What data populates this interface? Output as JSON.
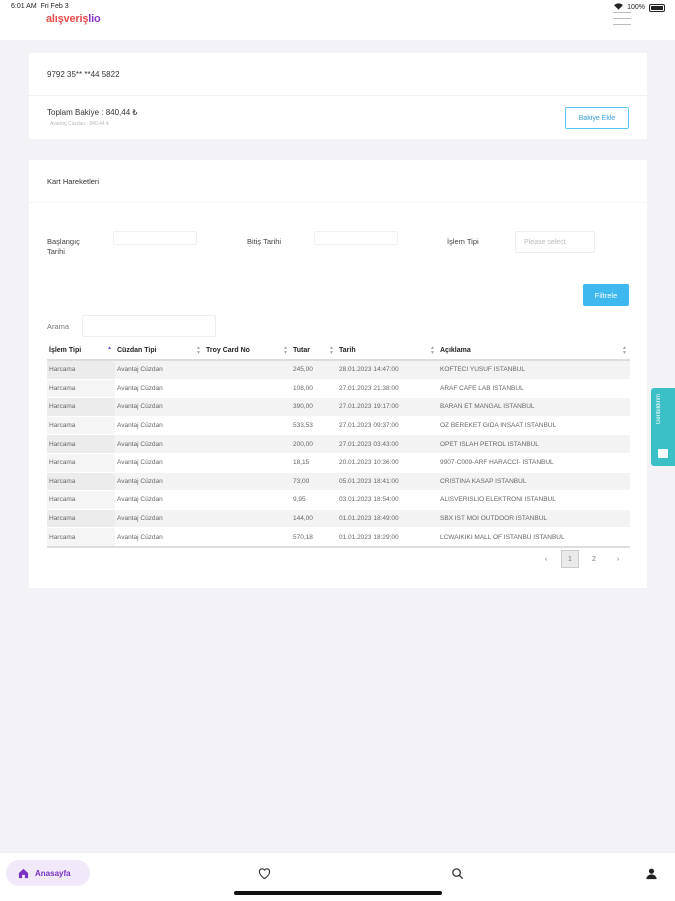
{
  "status_bar": {
    "time": "6:01 AM",
    "date": "Fri Feb 3",
    "battery": "100%"
  },
  "header": {
    "logo_part1": "alışveriş",
    "logo_part2": "lio",
    "menu_icon": "hamburger-icon"
  },
  "card_info": {
    "card_number": "9792 35** **44 5822",
    "balance_label": "Toplam Bakiye : 840,44 ₺",
    "balance_sub": "Avantaj Cüzdan : 840,44 ₺",
    "add_balance_button": "Bakiye Ekle"
  },
  "transactions": {
    "title": "Kart Hareketleri",
    "filters": {
      "start_label": "Başlangıç Tarihi",
      "end_label": "Bitiş Tarihi",
      "type_label": "İşlem Tipi",
      "type_placeholder": "Please select",
      "filter_button": "Filtrele"
    },
    "search_label": "Arama",
    "columns": [
      "İşlem Tipi",
      "Cüzdan Tipi",
      "Troy Card No",
      "Tutar",
      "Tarih",
      "Açıklama"
    ],
    "rows": [
      {
        "type": "Harcama",
        "wallet": "Avantaj Cüzdan",
        "card": "",
        "amount": "245,00",
        "date": "28.01.2023 14:47:00",
        "desc": "KOFTECI YUSUF ISTANBUL"
      },
      {
        "type": "Harcama",
        "wallet": "Avantaj Cüzdan",
        "card": "",
        "amount": "108,00",
        "date": "27.01.2023 21:38:00",
        "desc": "ARAF CAFE LAB ISTANBUL"
      },
      {
        "type": "Harcama",
        "wallet": "Avantaj Cüzdan",
        "card": "",
        "amount": "390,00",
        "date": "27.01.2023 19:17:00",
        "desc": "BARAN ET MANGAL ISTANBUL"
      },
      {
        "type": "Harcama",
        "wallet": "Avantaj Cüzdan",
        "card": "",
        "amount": "533,53",
        "date": "27.01.2023 09:37:00",
        "desc": "OZ BEREKET GIDA INSAAT ISTANBUL"
      },
      {
        "type": "Harcama",
        "wallet": "Avantaj Cüzdan",
        "card": "",
        "amount": "200,00",
        "date": "27.01.2023 03:43:00",
        "desc": "OPET ISLAH PETROL ISTANBUL"
      },
      {
        "type": "Harcama",
        "wallet": "Avantaj Cüzdan",
        "card": "",
        "amount": "18,15",
        "date": "20.01.2023 10:36:00",
        "desc": "9907-C009-ARF HARACCI- ISTANBUL"
      },
      {
        "type": "Harcama",
        "wallet": "Avantaj Cüzdan",
        "card": "",
        "amount": "73,00",
        "date": "05.01.2023 18:41:00",
        "desc": "CRISTINA KASAP ISTANBUL"
      },
      {
        "type": "Harcama",
        "wallet": "Avantaj Cüzdan",
        "card": "",
        "amount": "9,95",
        "date": "03.01.2023 18:54:00",
        "desc": "ALISVERISLIO ELEKTRONI ISTANBUL"
      },
      {
        "type": "Harcama",
        "wallet": "Avantaj Cüzdan",
        "card": "",
        "amount": "144,00",
        "date": "01.01.2023 18:49:00",
        "desc": "SBX IST MOI OUTDOOR ISTANBUL"
      },
      {
        "type": "Harcama",
        "wallet": "Avantaj Cüzdan",
        "card": "",
        "amount": "570,18",
        "date": "01.01.2023 18:29:00",
        "desc": "LCWAIKIKI MALL OF ISTANBU ISTANBUL"
      }
    ],
    "pagination": {
      "prev": "‹",
      "pages": [
        "1",
        "2"
      ],
      "active": "1",
      "next": "›"
    }
  },
  "side_tab": {
    "label": "Geribildirim"
  },
  "tab_bar": {
    "home_label": "Anasayfa",
    "icons": [
      "home-icon",
      "heart-icon",
      "search-icon",
      "user-icon"
    ]
  },
  "colors": {
    "accent": "#3fb8f0",
    "brand_purple": "#7a32c4",
    "brand_red": "#e84e4e",
    "feedback": "#3cc0c8"
  }
}
